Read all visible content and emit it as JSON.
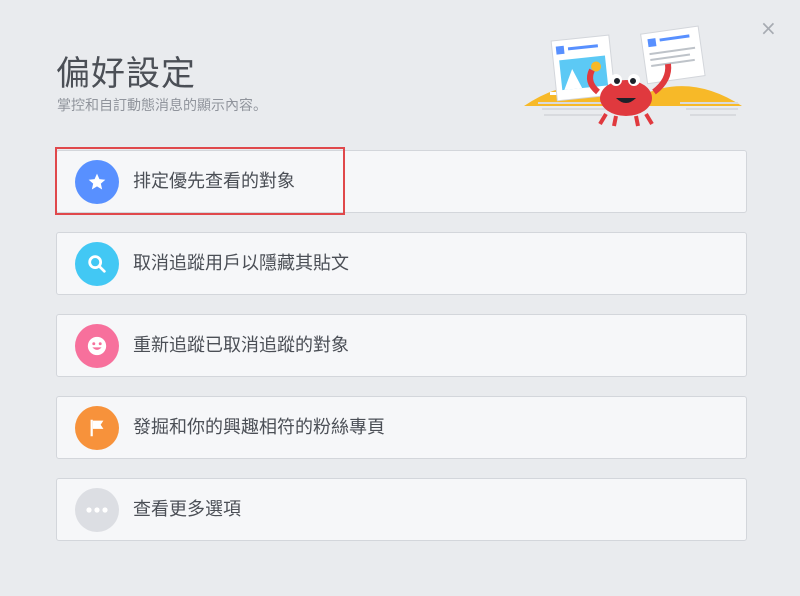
{
  "dialog": {
    "title": "偏好設定",
    "subtitle": "掌控和自訂動態消息的顯示內容。",
    "close_symbol": "×"
  },
  "options": [
    {
      "label": "排定優先查看的對象",
      "icon": "star-icon",
      "color": "#5890ff",
      "highlighted": true
    },
    {
      "label": "取消追蹤用戶以隱藏其貼文",
      "icon": "search-icon",
      "color": "#42c8f4"
    },
    {
      "label": "重新追蹤已取消追蹤的對象",
      "icon": "smiley-icon",
      "color": "#f7709c"
    },
    {
      "label": "發掘和你的興趣相符的粉絲專頁",
      "icon": "flag-icon",
      "color": "#f7923b"
    },
    {
      "label": "查看更多選項",
      "icon": "more-icon",
      "color": "#dcdee3"
    }
  ]
}
